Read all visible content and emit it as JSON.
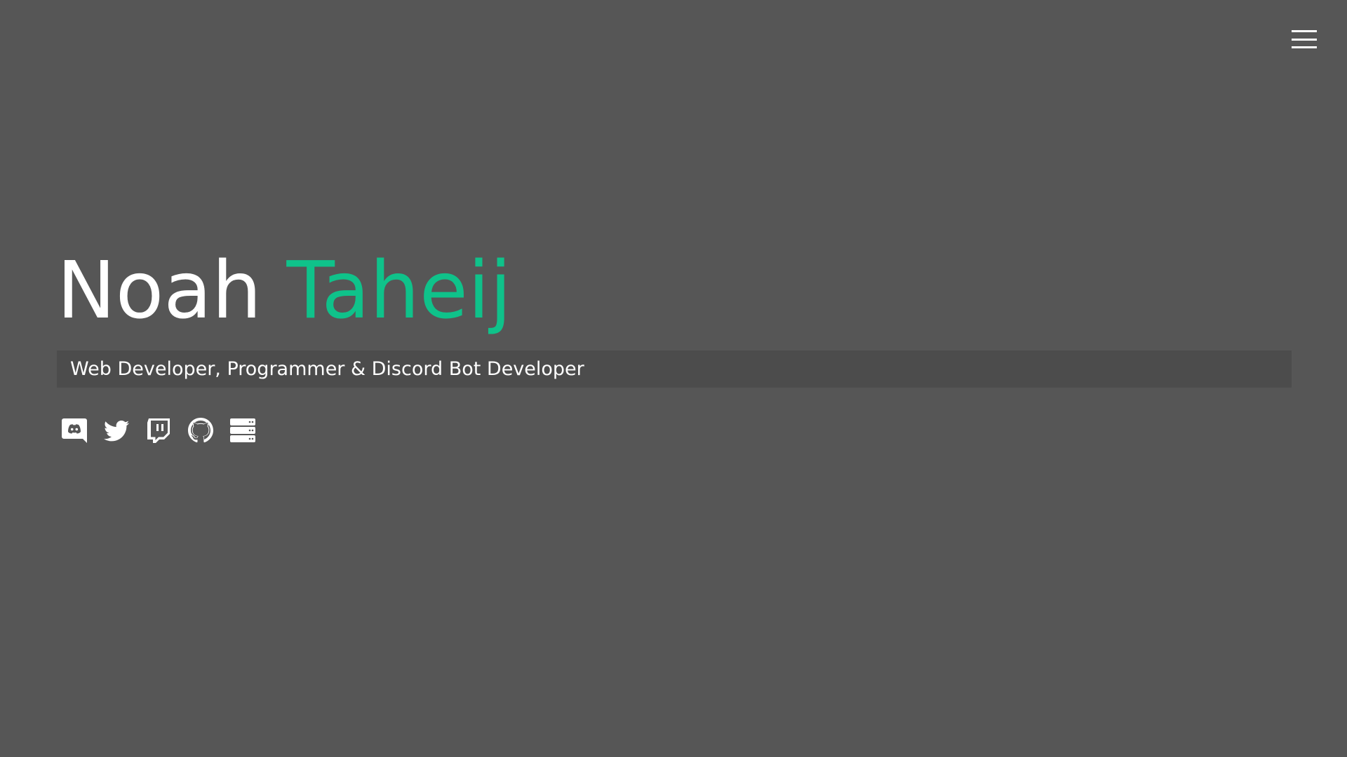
{
  "header": {
    "menu_icon": "hamburger-icon"
  },
  "hero": {
    "first_name": "Noah",
    "last_name": "Taheij",
    "tagline": "Web Developer, Programmer & Discord Bot Developer"
  },
  "socials": [
    {
      "icon": "discord-icon"
    },
    {
      "icon": "twitter-icon"
    },
    {
      "icon": "twitch-icon"
    },
    {
      "icon": "github-icon"
    },
    {
      "icon": "server-icon"
    }
  ],
  "colors": {
    "background": "#565656",
    "accent": "#0fc28a",
    "tagline_bar": "#4c4c4c",
    "text": "#ffffff"
  }
}
